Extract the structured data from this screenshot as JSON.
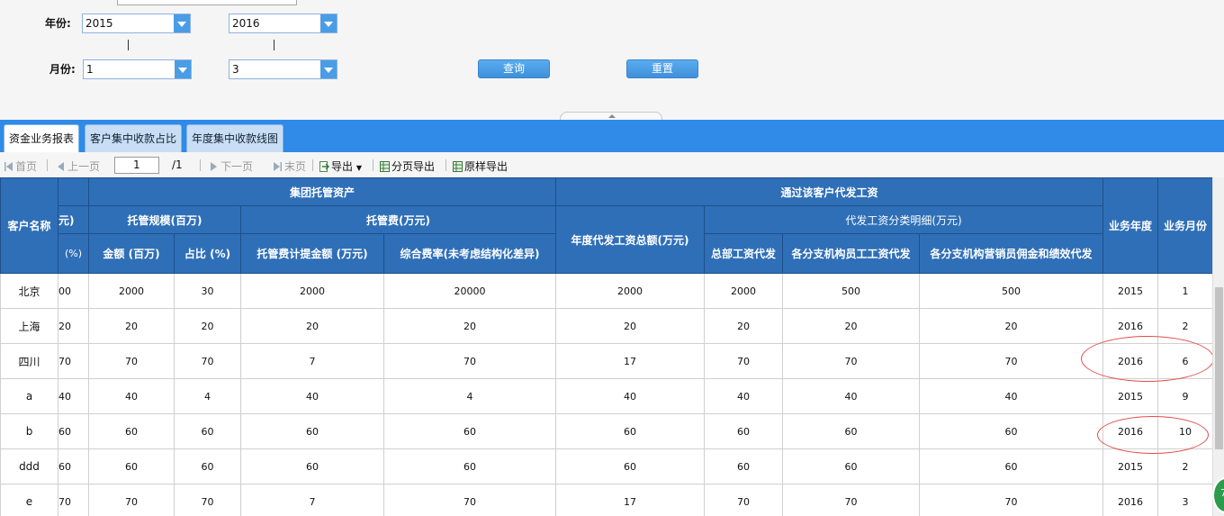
{
  "filter": {
    "year_label": "年份:",
    "month_label": "月份:",
    "year_from": "2015",
    "year_to": "2016",
    "month_from": "1",
    "month_to": "3",
    "query_label": "查询",
    "reset_label": "重置"
  },
  "tabs": [
    {
      "label": "资金业务报表"
    },
    {
      "label": "客户集中收款占比"
    },
    {
      "label": "年度集中收款线图"
    }
  ],
  "toolbar": {
    "first": "首页",
    "prev": "上一页",
    "page_value": "1",
    "page_total": "/1",
    "next": "下一页",
    "last": "末页",
    "export": "导出",
    "page_export": "分页导出",
    "orig_export": "原样导出"
  },
  "headers": {
    "customer": "客户名称",
    "cut_r1": "",
    "cut_r2": "元)",
    "cut_r3": "(%)",
    "group_assets": "集团托管资产",
    "custody_scale": "托管规模(百万)",
    "custody_fee": "托管费(万元)",
    "amount": "金额 (百万)",
    "ratio": "占比 (%)",
    "fee_amount": "托管费计提金额 (万元)",
    "composite_rate": "综合费率(未考虑结构化差异)",
    "payroll_group": "通过该客户代发工资",
    "annual_total": "年度代发工资总额(万元)",
    "payroll_detail": "代发工资分类明细(万元)",
    "hq": "总部工资代发",
    "branch_staff": "各分支机构员工工资代发",
    "branch_sales": "各分支机构营销员佣金和绩效代发",
    "biz_year": "业务年度",
    "biz_month": "业务月份"
  },
  "rows": [
    {
      "name": "北京",
      "c0": "00",
      "amount": "2000",
      "ratio": "30",
      "fee": "2000",
      "rate": "20000",
      "total": "2000",
      "hq": "2000",
      "staff": "500",
      "sales": "500",
      "year": "2015",
      "month": "1"
    },
    {
      "name": "上海",
      "c0": "20",
      "amount": "20",
      "ratio": "20",
      "fee": "20",
      "rate": "20",
      "total": "20",
      "hq": "20",
      "staff": "20",
      "sales": "20",
      "year": "2016",
      "month": "2"
    },
    {
      "name": "四川",
      "c0": "70",
      "amount": "70",
      "ratio": "70",
      "fee": "7",
      "rate": "70",
      "total": "17",
      "hq": "70",
      "staff": "70",
      "sales": "70",
      "year": "2016",
      "month": "6"
    },
    {
      "name": "a",
      "c0": "40",
      "amount": "40",
      "ratio": "4",
      "fee": "40",
      "rate": "4",
      "total": "40",
      "hq": "40",
      "staff": "40",
      "sales": "40",
      "year": "2015",
      "month": "9"
    },
    {
      "name": "b",
      "c0": "60",
      "amount": "60",
      "ratio": "60",
      "fee": "60",
      "rate": "60",
      "total": "60",
      "hq": "60",
      "staff": "60",
      "sales": "60",
      "year": "2016",
      "month": "10"
    },
    {
      "name": "ddd",
      "c0": "60",
      "amount": "60",
      "ratio": "60",
      "fee": "60",
      "rate": "60",
      "total": "60",
      "hq": "60",
      "staff": "60",
      "sales": "60",
      "year": "2015",
      "month": "2"
    },
    {
      "name": "e",
      "c0": "70",
      "amount": "70",
      "ratio": "70",
      "fee": "7",
      "rate": "70",
      "total": "17",
      "hq": "70",
      "staff": "70",
      "sales": "70",
      "year": "2016",
      "month": "3"
    }
  ],
  "colors": {
    "header_bg": "#2f6fb7",
    "tabbar_bg": "#2f8ae8",
    "button_bg": "#4a9de4",
    "annotation": "#e24b4b"
  }
}
